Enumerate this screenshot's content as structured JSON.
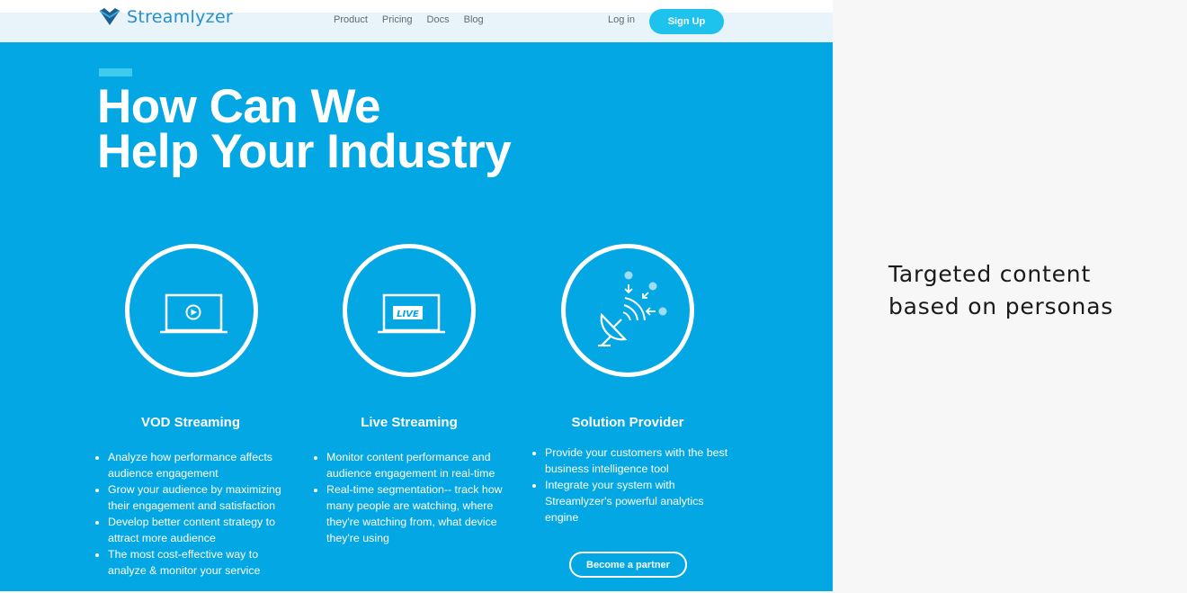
{
  "nav": {
    "brand": "Streamlyzer",
    "links": [
      "Product",
      "Pricing",
      "Docs",
      "Blog"
    ],
    "login": "Log in",
    "signup": "Sign Up"
  },
  "hero": {
    "headline_line1": "How Can We",
    "headline_line2": "Help Your Industry"
  },
  "columns": [
    {
      "title": "VOD Streaming",
      "bullets": [
        "Analyze how performance affects audience engagement",
        "Grow your audience by maximizing their engagement and satisfaction",
        "Develop better content strategy to attract more audience",
        "The most cost-effective way to analyze & monitor your service"
      ]
    },
    {
      "title": "Live Streaming",
      "icon_text": "LIVE",
      "bullets": [
        "Monitor content performance and audience engagement in real-time",
        "Real-time segmentation-- track how many people are watching, where they're watching from, what device they're using"
      ]
    },
    {
      "title": "Solution Provider",
      "bullets": [
        "Provide your customers with the best business intelligence tool",
        "Integrate your system with Streamlyzer's powerful analytics engine"
      ],
      "button": "Become a partner"
    }
  ],
  "caption": {
    "line1": "Targeted content",
    "line2": "based on personas"
  },
  "colors": {
    "hero_bg": "#03a7e3",
    "nav_bg": "#e9f4fa",
    "signup_bg": "#1ec3ed",
    "accent": "#3ecbee",
    "brand": "#2a8fc6"
  }
}
